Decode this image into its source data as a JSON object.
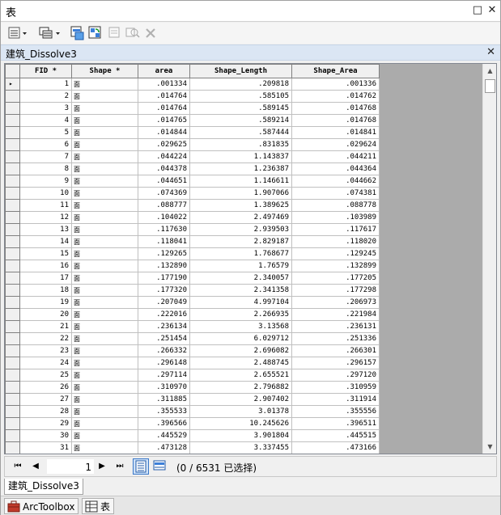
{
  "window": {
    "title": "表",
    "minimize_glyph": "□",
    "close_glyph": "✕"
  },
  "toolbar": {
    "icons": [
      "table-options-icon",
      "related-tables-icon",
      "select-by-attributes-icon",
      "switch-selection-icon",
      "clear-selection-icon",
      "zoom-to-selected-icon",
      "delete-selected-icon"
    ]
  },
  "layer_tab": {
    "name": "建筑_Dissolve3",
    "close_glyph": "✕"
  },
  "table": {
    "columns": [
      "FID *",
      "Shape *",
      "area",
      "Shape_Length",
      "Shape_Area"
    ],
    "shape_value": "面",
    "current_row_marker": "▸",
    "rows": [
      [
        "1",
        ".001334",
        ".209818",
        ".001336"
      ],
      [
        "2",
        ".014764",
        ".585105",
        ".014762"
      ],
      [
        "3",
        ".014764",
        ".589145",
        ".014768"
      ],
      [
        "4",
        ".014765",
        ".589214",
        ".014768"
      ],
      [
        "5",
        ".014844",
        ".587444",
        ".014841"
      ],
      [
        "6",
        ".029625",
        ".831835",
        ".029624"
      ],
      [
        "7",
        ".044224",
        "1.143837",
        ".044211"
      ],
      [
        "8",
        ".044378",
        "1.236387",
        ".044364"
      ],
      [
        "9",
        ".044651",
        "1.146611",
        ".044662"
      ],
      [
        "10",
        ".074369",
        "1.907066",
        ".074381"
      ],
      [
        "11",
        ".088777",
        "1.389625",
        ".088778"
      ],
      [
        "12",
        ".104022",
        "2.497469",
        ".103989"
      ],
      [
        "13",
        ".117630",
        "2.939503",
        ".117617"
      ],
      [
        "14",
        ".118041",
        "2.829187",
        ".118020"
      ],
      [
        "15",
        ".129265",
        "1.768677",
        ".129245"
      ],
      [
        "16",
        ".132890",
        "1.76579",
        ".132899"
      ],
      [
        "17",
        ".177190",
        "2.340057",
        ".177205"
      ],
      [
        "18",
        ".177320",
        "2.341358",
        ".177298"
      ],
      [
        "19",
        ".207049",
        "4.997104",
        ".206973"
      ],
      [
        "20",
        ".222016",
        "2.266935",
        ".221984"
      ],
      [
        "21",
        ".236134",
        "3.13568",
        ".236131"
      ],
      [
        "22",
        ".251454",
        "6.029712",
        ".251336"
      ],
      [
        "23",
        ".266332",
        "2.696082",
        ".266301"
      ],
      [
        "24",
        ".296148",
        "2.488745",
        ".296157"
      ],
      [
        "25",
        ".297114",
        "2.655521",
        ".297120"
      ],
      [
        "26",
        ".310970",
        "2.796882",
        ".310959"
      ],
      [
        "27",
        ".311885",
        "2.907402",
        ".311914"
      ],
      [
        "28",
        ".355533",
        "3.01378",
        ".355556"
      ],
      [
        "29",
        ".396566",
        "10.245626",
        ".396511"
      ],
      [
        "30",
        ".445529",
        "3.901804",
        ".445515"
      ],
      [
        "31",
        ".473128",
        "3.337455",
        ".473166"
      ]
    ]
  },
  "navigation": {
    "first_glyph": "⏮",
    "prev_glyph": "◀",
    "next_glyph": "▶",
    "last_glyph": "⏭",
    "current_record": "1",
    "selection_status": "(0 / 6531 已选择)"
  },
  "bottom_tab": {
    "label": "建筑_Dissolve3"
  },
  "dock": {
    "arctoolbox_label": "ArcToolbox",
    "table_label": "表"
  },
  "colors": {
    "layer_tab_bg": "#dbe6f4",
    "active_view": "#cfe1f7",
    "grid_bg": "#ababab"
  }
}
